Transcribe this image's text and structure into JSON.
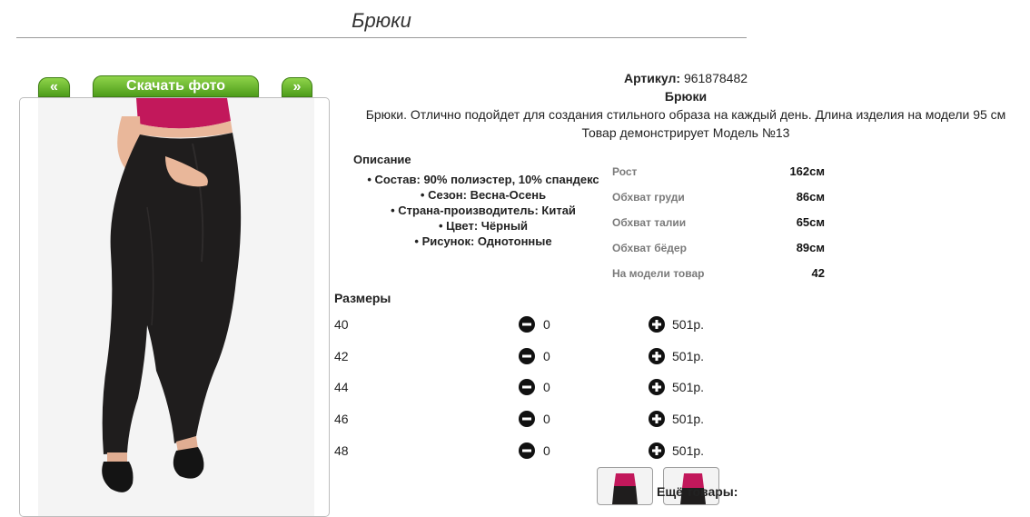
{
  "page": {
    "title": "Брюки"
  },
  "nav": {
    "prev_label": "«",
    "download_label": "Скачать фото",
    "next_label": "»"
  },
  "product": {
    "article_label": "Артикул:",
    "article_value": "961878482",
    "name": "Брюки",
    "summary": "Брюки. Отлично подойдет для создания стильного образа на каждый день. Длина изделия на модели 95 см",
    "model_note": "Товар демонстрирует Модель №13"
  },
  "description": {
    "heading": "Описание",
    "items": [
      "Состав: 90% полиэстер, 10% спандекс",
      "Сезон: Весна-Осень",
      "Страна-производитель: Китай",
      "Цвет: Чёрный",
      "Рисунок: Однотонные"
    ]
  },
  "model_measurements": [
    {
      "label": "Рост",
      "value": "162см"
    },
    {
      "label": "Обхват груди",
      "value": "86см"
    },
    {
      "label": "Обхват талии",
      "value": "65см"
    },
    {
      "label": "Обхват бёдер",
      "value": "89см"
    },
    {
      "label": "На модели товар",
      "value": "42"
    }
  ],
  "sizes": {
    "heading": "Размеры",
    "rows": [
      {
        "size": "40",
        "qty": "0",
        "price": "501р."
      },
      {
        "size": "42",
        "qty": "0",
        "price": "501р."
      },
      {
        "size": "44",
        "qty": "0",
        "price": "501р."
      },
      {
        "size": "46",
        "qty": "0",
        "price": "501р."
      },
      {
        "size": "48",
        "qty": "0",
        "price": "501р."
      }
    ]
  },
  "more": {
    "label": "Ещё товары:"
  },
  "colors": {
    "button_green": "#5fb22a",
    "pants": "#1f1d1d",
    "top": "#c2185b",
    "skin": "#e9b79a"
  },
  "icons": {
    "minus": "minus-circle-icon",
    "plus": "plus-circle-icon"
  }
}
